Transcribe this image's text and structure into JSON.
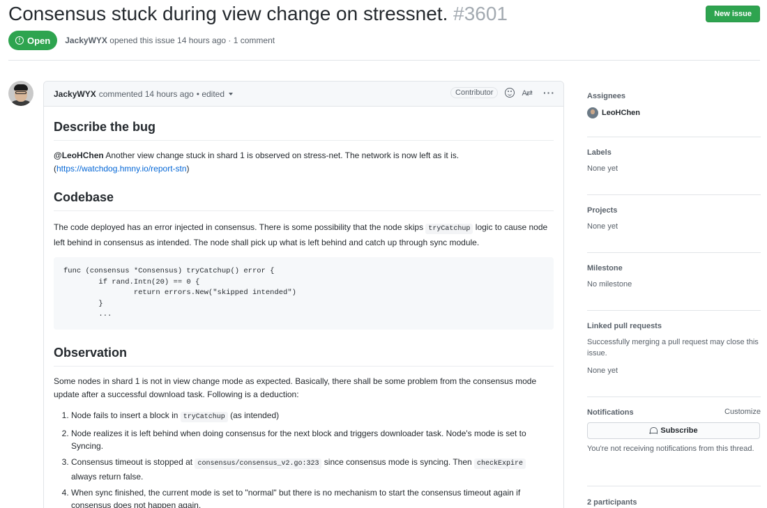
{
  "issue": {
    "title": "Consensus stuck during view change on stressnet.",
    "number": "#3601",
    "state": "Open",
    "author": "JackyWYX",
    "opened_text": "opened this issue 14 hours ago · 1 comment",
    "new_issue_label": "New issue"
  },
  "comment": {
    "author": "JackyWYX",
    "meta": "commented 14 hours ago",
    "edited": "• edited",
    "role": "Contributor",
    "kebab": "···",
    "translate": "A⇄",
    "sections": {
      "bug_heading": "Describe the bug",
      "bug_mention": "@LeoHChen",
      "bug_text": " Another view change stuck in shard 1 is observed on stress-net. The network is now left as it is.",
      "bug_link_open": "(",
      "bug_link": "https://watchdog.hmny.io/report-stn",
      "bug_link_close": ")",
      "codebase_heading": "Codebase",
      "codebase_text_1": "The code deployed has an error injected in consensus. There is some possibility that the node skips ",
      "codebase_code": "tryCatchup",
      "codebase_text_2": " logic to cause node left behind in consensus as intended. The node shall pick up what is left behind and catch up through sync module.",
      "code_block": "func (consensus *Consensus) tryCatchup() error {\n        if rand.Intn(20) == 0 {\n                return errors.New(\"skipped intended\")\n        }\n        ...",
      "observation_heading": "Observation",
      "observation_text": "Some nodes in shard 1 is not in view change mode as expected. Basically, there shall be some problem from the consensus mode update after a successful download task. Following is a deduction:",
      "list": {
        "item1_a": "Node fails to insert a block in ",
        "item1_code": "tryCatchup",
        "item1_b": " (as intended)",
        "item2": "Node realizes it is left behind when doing consensus for the next block and triggers downloader task. Node's mode is set to Syncing.",
        "item3_a": "Consensus timeout is stopped at ",
        "item3_code": "consensus/consensus_v2.go:323",
        "item3_b": " since consensus mode is syncing. Then ",
        "item3_code2": "checkExpire",
        "item3_c": " always return false.",
        "item4": "When sync finished, the current mode is set to \"normal\" but there is no mechanism to start the consensus timeout again if consensus does not happen again."
      }
    }
  },
  "sidebar": {
    "assignees_heading": "Assignees",
    "assignee_name": "LeoHChen",
    "labels_heading": "Labels",
    "labels_value": "None yet",
    "projects_heading": "Projects",
    "projects_value": "None yet",
    "milestone_heading": "Milestone",
    "milestone_value": "No milestone",
    "linked_heading": "Linked pull requests",
    "linked_desc": "Successfully merging a pull request may close this issue.",
    "linked_value": "None yet",
    "notifications_heading": "Notifications",
    "customize_label": "Customize",
    "subscribe_label": "Subscribe",
    "notifications_desc": "You're not receiving notifications from this thread.",
    "participants_heading": "2 participants"
  },
  "colors": {
    "open_green": "#2ea44f",
    "link_blue": "#0366d6"
  }
}
